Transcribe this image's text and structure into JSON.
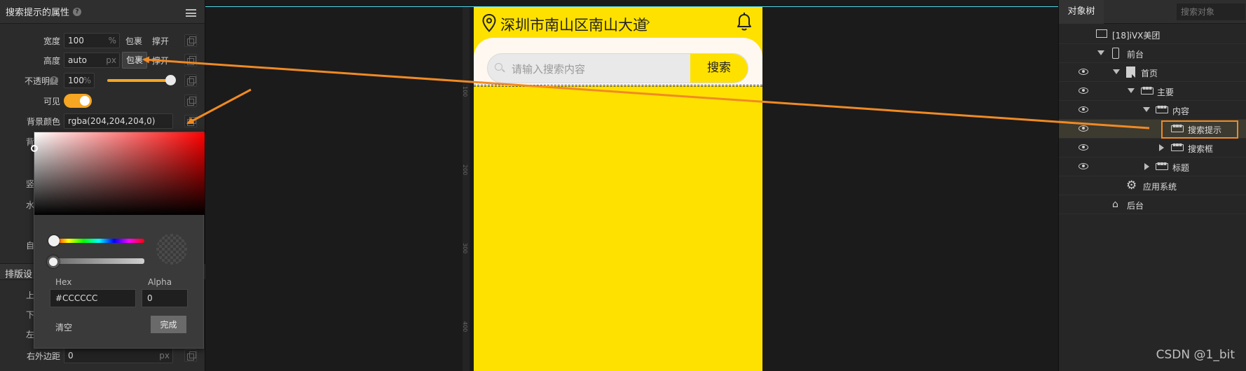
{
  "left_panel": {
    "title": "搜索提示的属性",
    "help": "?",
    "width": {
      "label": "宽度",
      "value": "100",
      "unit": "%",
      "opt1": "包裹",
      "opt2": "撑开"
    },
    "height": {
      "label": "高度",
      "value": "auto",
      "unit": "px",
      "opt1": "包裹",
      "opt2": "撑开"
    },
    "opacity": {
      "label": "不透明度",
      "help": "?",
      "value": "100",
      "unit": "%",
      "level": 1.0
    },
    "visible": {
      "label": "可见",
      "on": true
    },
    "bg_color": {
      "label": "背景颜色",
      "value": "rgba(204,204,204,0)"
    },
    "stub_labels": [
      "背",
      "竖",
      "水",
      "自"
    ],
    "section": "排版设",
    "stub_labels2": [
      "上",
      "下",
      "左"
    ],
    "margin_right": {
      "label": "右外边距",
      "value": "0",
      "unit": "px"
    }
  },
  "color_picker": {
    "hex_label": "Hex",
    "alpha_label": "Alpha",
    "hex_value": "#CCCCCC",
    "alpha_value": "0",
    "clear_label": "清空",
    "done_label": "完成"
  },
  "ruler": {
    "marks": [
      "100",
      "200",
      "300",
      "400"
    ]
  },
  "phone": {
    "city": "深圳市南山区南山大道",
    "chevron": "›",
    "search_placeholder": "请输入搜索内容",
    "search_button": "搜索",
    "bg_color": "#ffe100"
  },
  "right_panel": {
    "tab": "对象树",
    "search_placeholder": "搜索对象",
    "items": [
      {
        "label": "[18]iVX美团"
      },
      {
        "label": "前台"
      },
      {
        "label": "首页"
      },
      {
        "label": "主要"
      },
      {
        "label": "内容"
      },
      {
        "label": "搜索提示"
      },
      {
        "label": "搜索框"
      },
      {
        "label": "标题"
      },
      {
        "label": "应用系统"
      },
      {
        "label": "后台"
      }
    ]
  },
  "watermark": "CSDN @1_bit",
  "colors": {
    "accent": "#f5a623",
    "arrow": "#f08a24",
    "ruler_line": "#4fd6e6"
  }
}
